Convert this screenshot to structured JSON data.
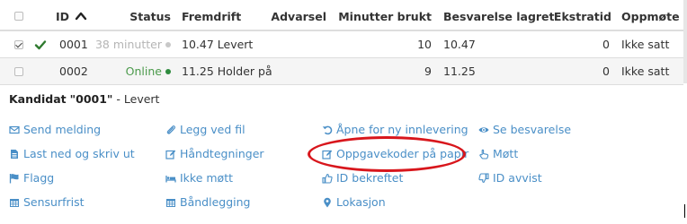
{
  "table": {
    "headers": {
      "id": "ID",
      "status": "Status",
      "progress": "Fremdrift",
      "warning": "Advarsel",
      "minutes_used": "Minutter brukt",
      "answer_saved": "Besvarelse lagret",
      "extra_time": "Ekstratid",
      "attendance": "Oppmøte"
    },
    "rows": [
      {
        "checked": true,
        "id": "0001",
        "status": "38 minutter",
        "status_color": "#c8c8c8",
        "progress": "10.47 Levert",
        "warning": "",
        "minutes_used": "10",
        "answer_saved": "10.47",
        "extra_time": "0",
        "attendance": "Ikke satt"
      },
      {
        "checked": false,
        "id": "0002",
        "status": "Online",
        "status_color": "#2e8b3e",
        "progress": "11.25 Holder på",
        "warning": "",
        "minutes_used": "9",
        "answer_saved": "11.25",
        "extra_time": "0",
        "attendance": "Ikke satt"
      }
    ]
  },
  "candidate": {
    "label": "Kandidat",
    "id_quoted": "\"0001\"",
    "state": " - Levert"
  },
  "actions": {
    "send_message": "Send melding",
    "attach_file": "Legg ved fil",
    "open_new_submission": "Åpne for ny innlevering",
    "view_answer": "Se besvarelse",
    "download_print": "Last ned og skriv ut",
    "hand_drawings": "Håndtegninger",
    "task_codes_paper": "Oppgavekoder på papir",
    "attended": "Møtt",
    "flag": "Flagg",
    "not_attended": "Ikke møtt",
    "id_confirmed": "ID bekreftet",
    "id_rejected": "ID avvist",
    "deadline": "Sensurfrist",
    "tape": "Båndlegging",
    "location": "Lokasjon"
  },
  "colors": {
    "link": "#4a8fc7",
    "highlight": "#d8161c",
    "check": "#2f7a2f"
  }
}
